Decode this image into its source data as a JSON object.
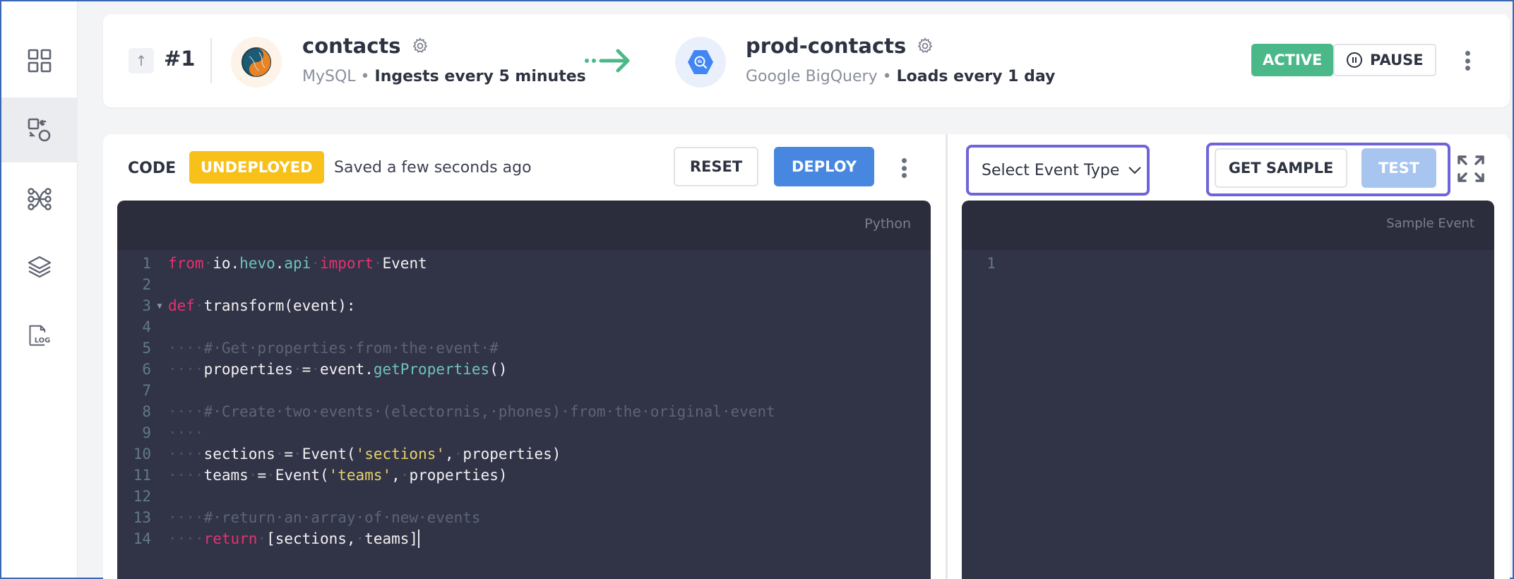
{
  "sidebar": {
    "items": [
      {
        "name": "dashboard",
        "icon": "grid-icon",
        "active": false
      },
      {
        "name": "pipelines",
        "icon": "pipeline-transform-icon",
        "active": true
      },
      {
        "name": "models",
        "icon": "workflow-nodes-icon",
        "active": false
      },
      {
        "name": "layers",
        "icon": "layers-icon",
        "active": false
      },
      {
        "name": "logs",
        "icon": "log-file-icon",
        "active": false,
        "label": "LOG"
      }
    ]
  },
  "header": {
    "pipeline_number": "#1",
    "source": {
      "name": "contacts",
      "type": "MySQL",
      "schedule": "Ingests every 5 minutes",
      "brand_colors": {
        "left": "#1f5a73",
        "right": "#e98324"
      }
    },
    "destination": {
      "name": "prod-contacts",
      "type": "Google BigQuery",
      "schedule": "Loads every 1 day",
      "brand_color": "#4285f4"
    },
    "separator": "•",
    "status": "ACTIVE",
    "pause_label": "PAUSE"
  },
  "code_panel": {
    "title": "CODE",
    "deploy_status": "UNDEPLOYED",
    "saved_text": "Saved a few seconds ago",
    "reset_label": "RESET",
    "deploy_label": "DEPLOY",
    "language": "Python",
    "lines": [
      {
        "n": "1",
        "tokens": [
          [
            "kw",
            "from"
          ],
          [
            "ws",
            "·"
          ],
          [
            "t",
            "io."
          ],
          [
            "mod",
            "hevo"
          ],
          [
            "t",
            "."
          ],
          [
            "mod",
            "api"
          ],
          [
            "ws",
            "·"
          ],
          [
            "kw",
            "import"
          ],
          [
            "ws",
            "·"
          ],
          [
            "t",
            "Event"
          ]
        ]
      },
      {
        "n": "2",
        "tokens": []
      },
      {
        "n": "3",
        "fold": true,
        "tokens": [
          [
            "kw",
            "def"
          ],
          [
            "ws",
            "·"
          ],
          [
            "t",
            "transform(event):"
          ]
        ]
      },
      {
        "n": "4",
        "tokens": []
      },
      {
        "n": "5",
        "tokens": [
          [
            "ws",
            "····"
          ],
          [
            "cm",
            "#·Get·properties·from·the·event·#"
          ]
        ]
      },
      {
        "n": "6",
        "tokens": [
          [
            "ws",
            "····"
          ],
          [
            "t",
            "properties"
          ],
          [
            "ws",
            "·"
          ],
          [
            "t",
            "="
          ],
          [
            "ws",
            "·"
          ],
          [
            "t",
            "event."
          ],
          [
            "fn",
            "getProperties"
          ],
          [
            "t",
            "()"
          ]
        ]
      },
      {
        "n": "7",
        "tokens": []
      },
      {
        "n": "8",
        "tokens": [
          [
            "ws",
            "····"
          ],
          [
            "cm",
            "#·Create·two·events·(electornis,·phones)·from·the·original·event"
          ]
        ]
      },
      {
        "n": "9",
        "tokens": [
          [
            "ws",
            "····"
          ]
        ]
      },
      {
        "n": "10",
        "tokens": [
          [
            "ws",
            "····"
          ],
          [
            "t",
            "sections"
          ],
          [
            "ws",
            "·"
          ],
          [
            "t",
            "="
          ],
          [
            "ws",
            "·"
          ],
          [
            "t",
            "Event("
          ],
          [
            "str",
            "'sections'"
          ],
          [
            "t",
            ","
          ],
          [
            "ws",
            "·"
          ],
          [
            "t",
            "properties)"
          ]
        ]
      },
      {
        "n": "11",
        "tokens": [
          [
            "ws",
            "····"
          ],
          [
            "t",
            "teams"
          ],
          [
            "ws",
            "·"
          ],
          [
            "t",
            "="
          ],
          [
            "ws",
            "·"
          ],
          [
            "t",
            "Event("
          ],
          [
            "str",
            "'teams'"
          ],
          [
            "t",
            ","
          ],
          [
            "ws",
            "·"
          ],
          [
            "t",
            "properties)"
          ]
        ]
      },
      {
        "n": "12",
        "tokens": []
      },
      {
        "n": "13",
        "tokens": [
          [
            "ws",
            "····"
          ],
          [
            "cm",
            "#·return·an·array·of·new·events"
          ]
        ]
      },
      {
        "n": "14",
        "cursor": true,
        "tokens": [
          [
            "ws",
            "····"
          ],
          [
            "kw",
            "return"
          ],
          [
            "ws",
            "·"
          ],
          [
            "t",
            "[sections,"
          ],
          [
            "ws",
            "·"
          ],
          [
            "t",
            "teams]"
          ]
        ]
      }
    ]
  },
  "sample_panel": {
    "event_type_placeholder": "Select Event Type",
    "get_sample_label": "GET SAMPLE",
    "test_label": "TEST",
    "editor_label": "Sample Event",
    "lines": [
      {
        "n": "1"
      }
    ]
  },
  "colors": {
    "active": "#4bb88a",
    "undeployed": "#f7c11a",
    "primary": "#4787e0",
    "focus_outline": "#6f64d8",
    "editor_bg": "#313347"
  }
}
